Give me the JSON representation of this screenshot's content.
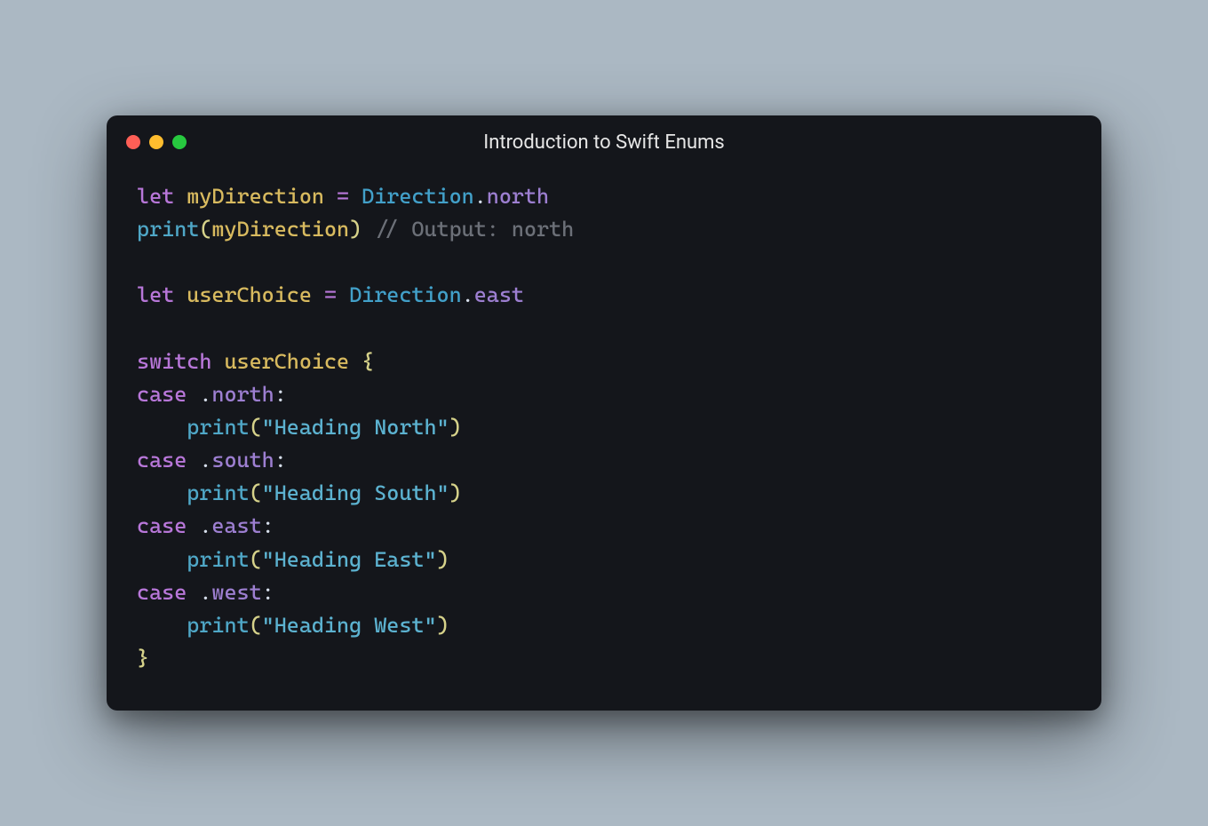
{
  "window": {
    "title": "Introduction to Swift Enums",
    "dots": {
      "red": "#ff5f56",
      "yellow": "#ffbd2e",
      "green": "#27c93f"
    }
  },
  "code": {
    "line1": {
      "let": "let",
      "var": "myDirection",
      "eq": "=",
      "type": "Direction",
      "dot": ".",
      "case": "north"
    },
    "line2": {
      "fn": "print",
      "lp": "(",
      "arg": "myDirection",
      "rp": ")",
      "comment": "// Output: north"
    },
    "line4": {
      "let": "let",
      "var": "userChoice",
      "eq": "=",
      "type": "Direction",
      "dot": ".",
      "case": "east"
    },
    "line6": {
      "switch": "switch",
      "var": "userChoice",
      "brace": "{"
    },
    "cases": [
      {
        "kw": "case",
        "dot": ".",
        "name": "north",
        "colon": ":",
        "fn": "print",
        "lp": "(",
        "str": "\"Heading North\"",
        "rp": ")"
      },
      {
        "kw": "case",
        "dot": ".",
        "name": "south",
        "colon": ":",
        "fn": "print",
        "lp": "(",
        "str": "\"Heading South\"",
        "rp": ")"
      },
      {
        "kw": "case",
        "dot": ".",
        "name": "east",
        "colon": ":",
        "fn": "print",
        "lp": "(",
        "str": "\"Heading East\"",
        "rp": ")"
      },
      {
        "kw": "case",
        "dot": ".",
        "name": "west",
        "colon": ":",
        "fn": "print",
        "lp": "(",
        "str": "\"Heading West\"",
        "rp": ")"
      }
    ],
    "close_brace": "}"
  }
}
